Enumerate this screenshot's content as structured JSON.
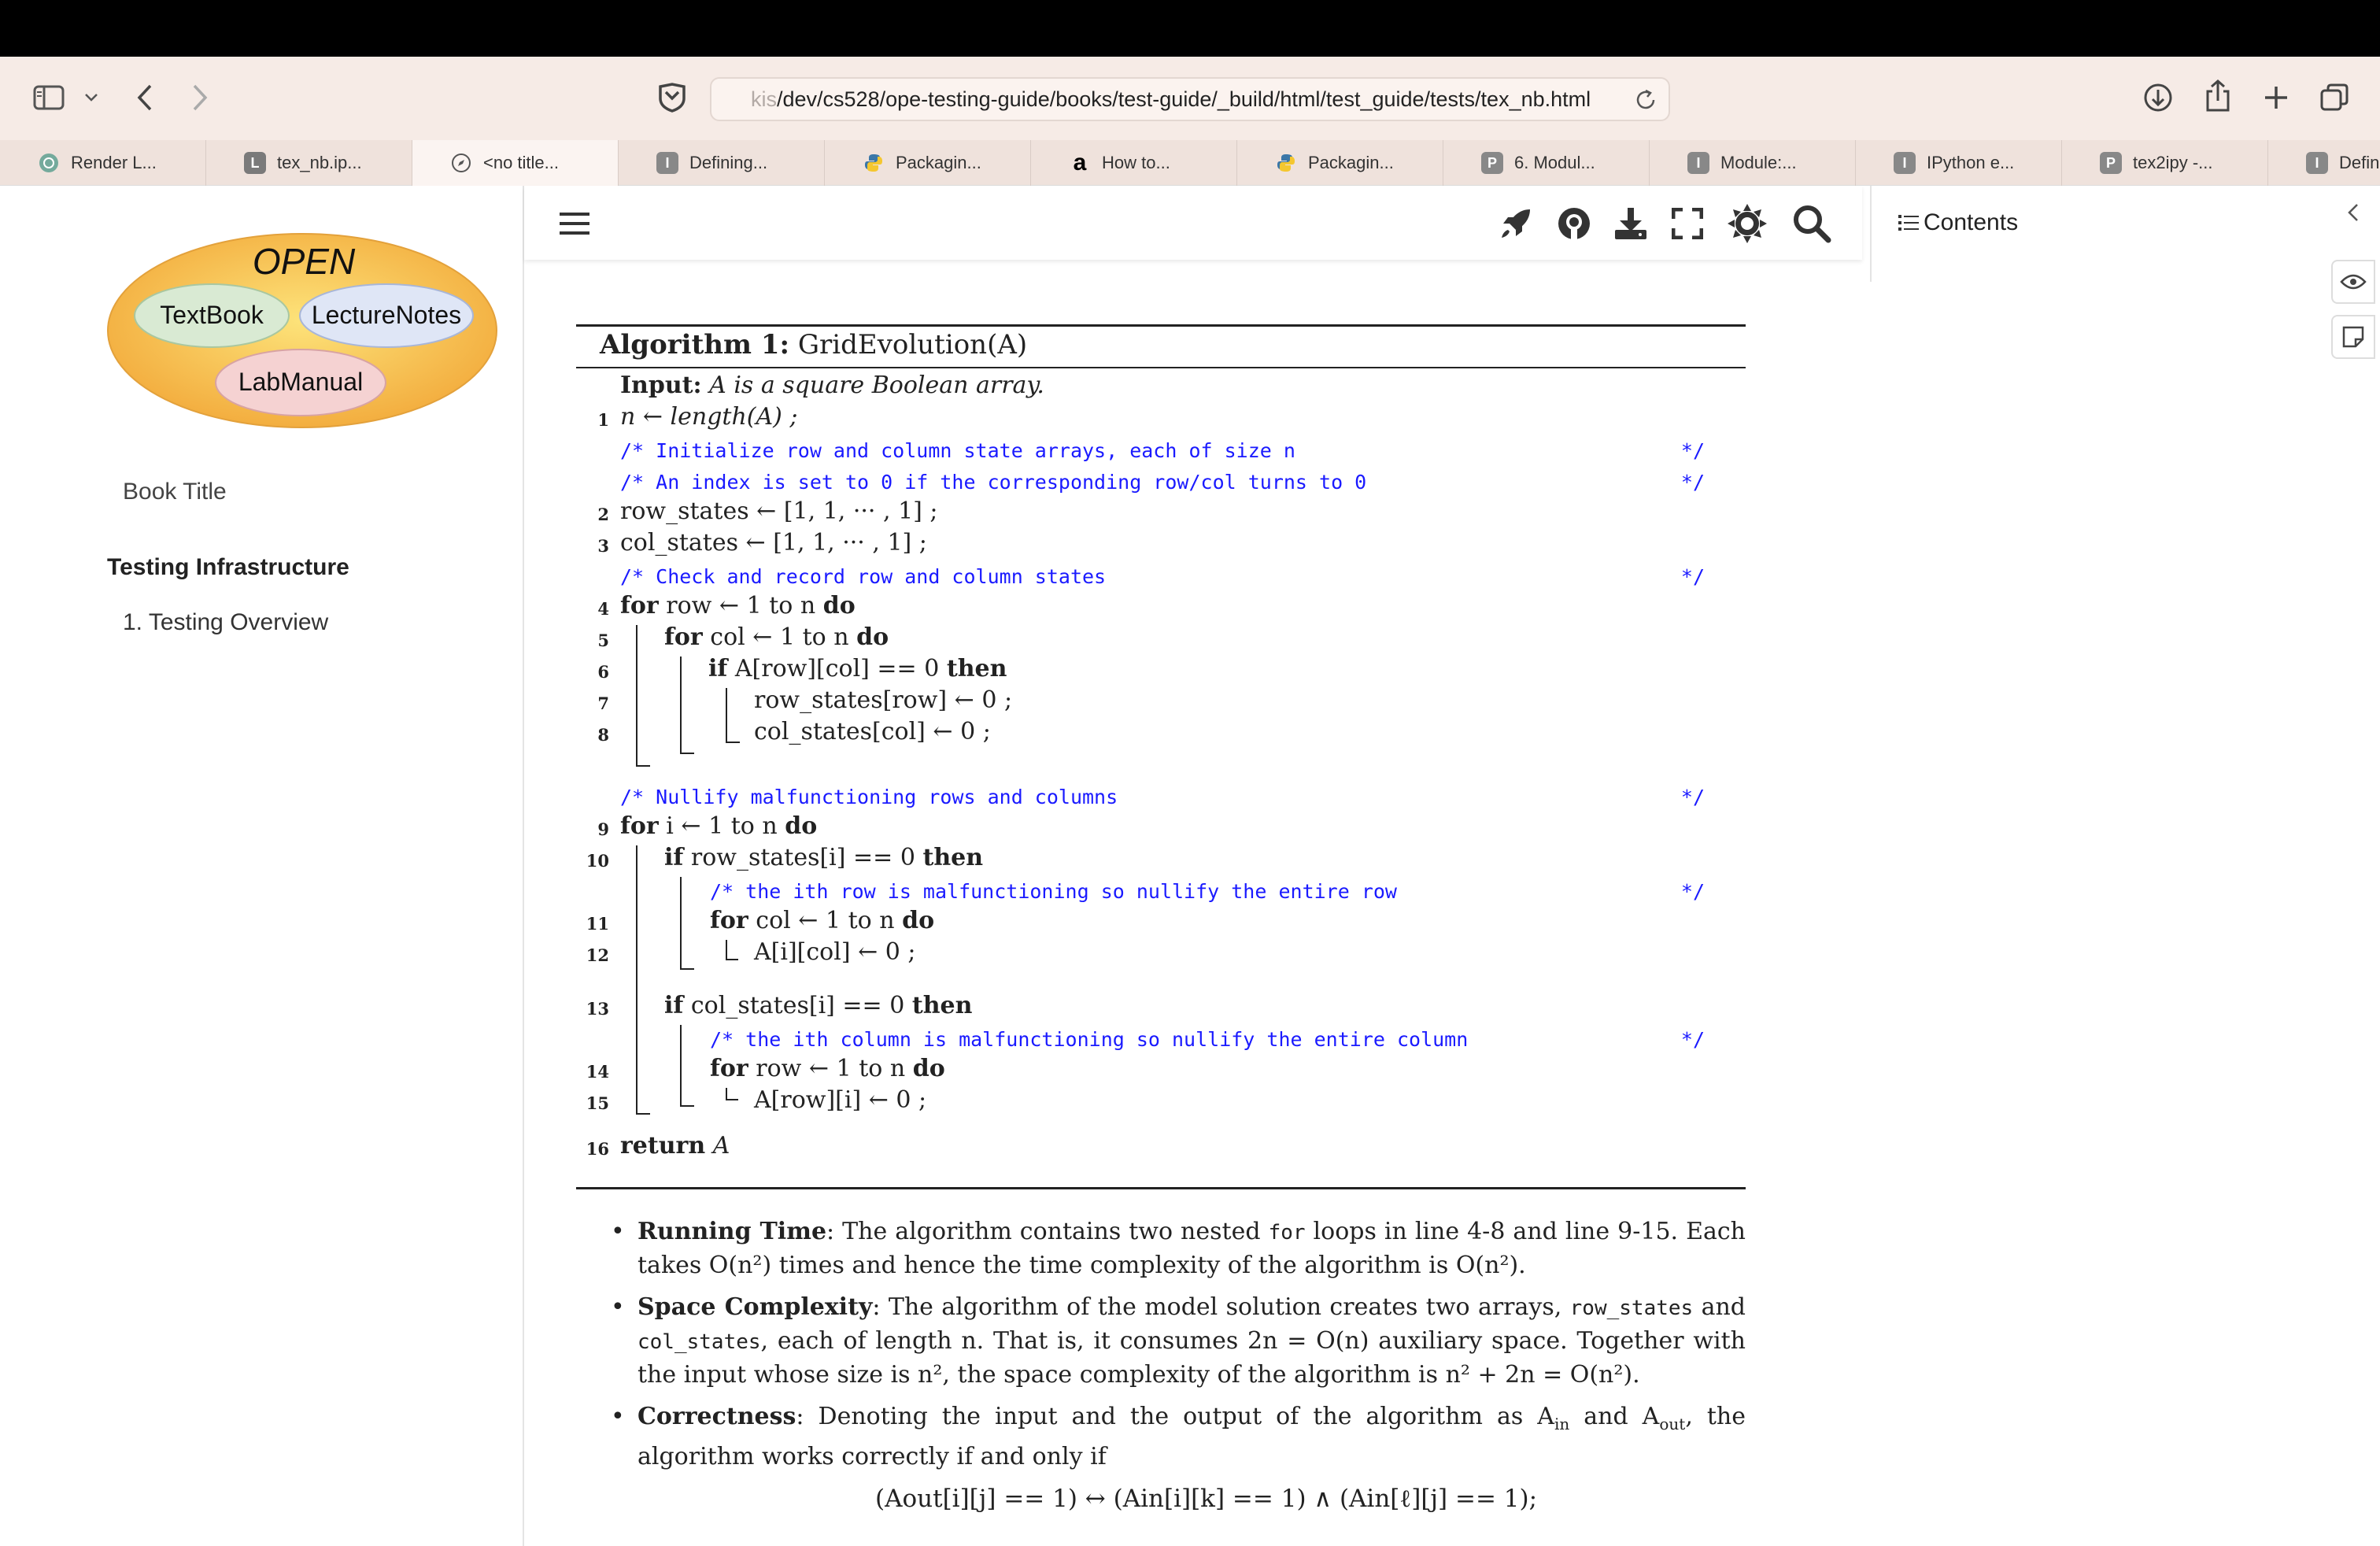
{
  "browser": {
    "url_faded": "kis",
    "url": "/dev/cs528/ope-testing-guide/books/test-guide/_build/html/test_guide/tests/tex_nb.html",
    "tabs": [
      {
        "label": "Render L...",
        "icon": "openai-icon",
        "color": "#8aa"
      },
      {
        "label": "tex_nb.ip...",
        "icon": "L",
        "color": "#7a7a7a"
      },
      {
        "label": "<no title...",
        "icon": "compass-icon",
        "color": "#666"
      },
      {
        "label": "Defining...",
        "icon": "I",
        "color": "#888"
      },
      {
        "label": "Packagin...",
        "icon": "python-icon",
        "color": "#3b77a8"
      },
      {
        "label": "How to...",
        "icon": "a",
        "color": "#000"
      },
      {
        "label": "Packagin...",
        "icon": "python-icon",
        "color": "#3b77a8"
      },
      {
        "label": "6. Modul...",
        "icon": "P",
        "color": "#888"
      },
      {
        "label": "Module:...",
        "icon": "I",
        "color": "#888"
      },
      {
        "label": "IPython e...",
        "icon": "I",
        "color": "#888"
      },
      {
        "label": "tex2ipy -...",
        "icon": "P",
        "color": "#888"
      },
      {
        "label": "Defining...",
        "icon": "I",
        "color": "#888"
      }
    ]
  },
  "sidebar": {
    "logo": {
      "top": "OPEN",
      "left": "TextBook",
      "right": "LectureNotes",
      "bottom": "LabManual"
    },
    "book_title": "Book Title",
    "section": "Testing Infrastructure",
    "item": "1. Testing Overview"
  },
  "right": {
    "contents_label": "Contents"
  },
  "algorithm": {
    "title_prefix": "Algorithm 1:",
    "title_name": "GridEvolution(A)",
    "input_label": "Input:",
    "input_text": "A is a square Boolean array.",
    "comment_end": "*/",
    "l1": "n ← length(A) ;",
    "c1": "/* Initialize row and column state arrays, each of size n",
    "c2": "/* An index is set to 0 if the corresponding row/col turns to 0",
    "l2": "row_states ← [1, 1, ··· , 1] ;",
    "l3": "col_states ← [1, 1, ··· , 1] ;",
    "c3": "/* Check and record row and column states",
    "l4_kw": "for",
    "l4": "row ← 1 to n",
    "do": "do",
    "l5": "col ← 1 to n",
    "if": "if",
    "then": "then",
    "l6": "A[row][col] == 0",
    "l7": "row_states[row] ← 0 ;",
    "l8": "col_states[col] ← 0 ;",
    "c4": "/* Nullify malfunctioning rows and columns",
    "l9": "i ← 1 to n",
    "l10": "row_states[i] == 0",
    "c5": "/* the ith row is malfunctioning so nullify the entire row",
    "l11": "col ← 1 to n",
    "l12": "A[i][col] ← 0 ;",
    "l13": "col_states[i] == 0",
    "c6": "/* the ith column is malfunctioning so nullify the entire column",
    "l14": "row ← 1 to n",
    "l15": "A[row][i] ← 0 ;",
    "return_kw": "return",
    "l16": "A",
    "line_numbers": [
      "1",
      "2",
      "3",
      "4",
      "5",
      "6",
      "7",
      "8",
      "9",
      "10",
      "11",
      "12",
      "13",
      "14",
      "15",
      "16"
    ]
  },
  "bullets": {
    "b1_head": "Running Time",
    "b1_a": ": The algorithm contains two nested ",
    "b1_code": "for",
    "b1_b": " loops in line 4-8 and line 9-15. Each takes O(n²) times and hence the time complexity of the algorithm is O(n²).",
    "b2_head": "Space Complexity",
    "b2_a": ": The algorithm of the model solution creates two arrays, ",
    "b2_code1": "row_states",
    "b2_b": " and ",
    "b2_code2": "col_states",
    "b2_c": ", each of length n. That is, it consumes 2n = O(n) auxiliary space. Together with the input whose size is n², the space complexity of the algorithm is n² + 2n = O(n²).",
    "b3_head": "Correctness",
    "b3_a": ": Denoting the input and the output of the algorithm as A",
    "b3_in": "in",
    "b3_b": " and A",
    "b3_out": "out",
    "b3_c": ", the algorithm works correctly if and only if",
    "formula": "(Aout[i][j] == 1) ↔ (Ain[i][k] == 1) ∧ (Ain[ℓ][j] == 1);"
  }
}
